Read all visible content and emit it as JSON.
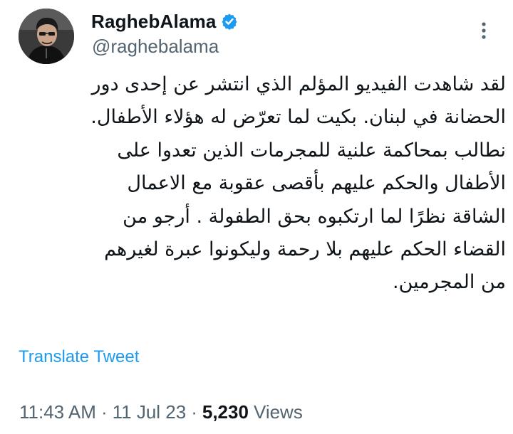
{
  "author": {
    "display_name": "RaghebAlama",
    "handle": "@raghebalama",
    "verified": true,
    "avatar_icon": "avatar-photo",
    "verified_icon": "verified-badge-icon"
  },
  "tweet": {
    "lines": [
      "لقد شاهدت الفيديو المؤلم الذي انتشر عن إحدى دور",
      "الحضانة في لبنان. بكيت لما تعرّض له هؤلاء الأطفال.",
      "نطالب بمحاكمة علنية  للمجرمات الذين تعدوا على",
      "الأطفال والحكم عليهم بأقصى عقوبة مع الاعمال",
      "الشاقة نظرًا لما ارتكبوه بحق الطفولة . أرجو من",
      "القضاء الحكم عليهم بلا رحمة وليكونوا عبرة لغيرهم",
      "من المجرمين."
    ],
    "translate_label": "Translate Tweet"
  },
  "meta": {
    "time": "11:43 AM",
    "separator": "·",
    "date": "11 Jul 23",
    "views_count": "5,230",
    "views_label": "Views"
  },
  "colors": {
    "text_primary": "#0f1419",
    "text_secondary": "#536471",
    "accent": "#1d9bf0"
  }
}
